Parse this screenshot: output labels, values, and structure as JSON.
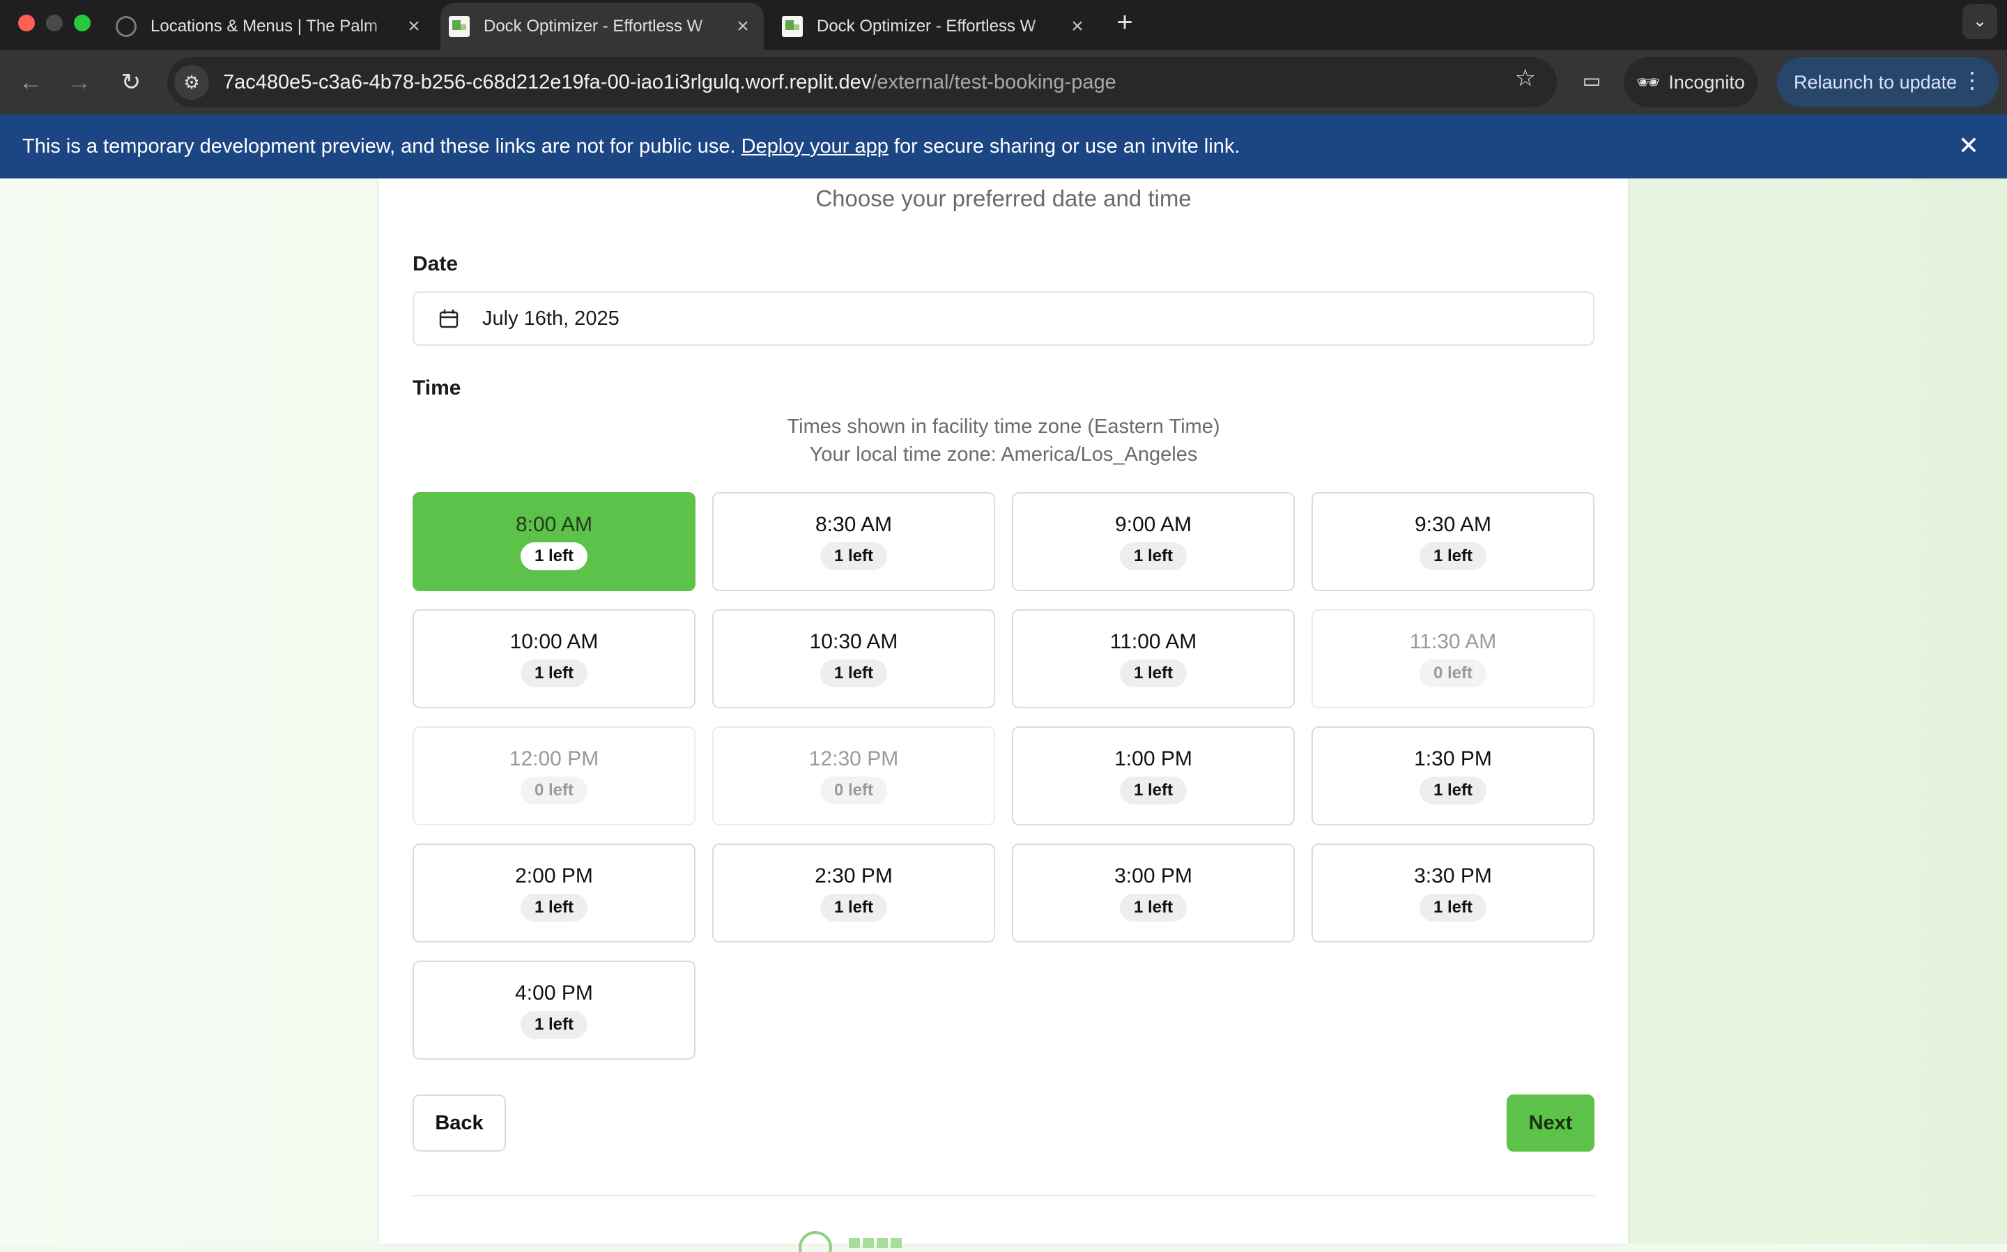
{
  "browser": {
    "tabs": [
      {
        "title": "Locations & Menus | The Palm"
      },
      {
        "title": "Dock Optimizer - Effortless W"
      },
      {
        "title": "Dock Optimizer - Effortless W"
      }
    ],
    "url_host": "7ac480e5-c3a6-4b78-b256-c68d212e19fa-00-iao1i3rlgulq.worf.replit.dev",
    "url_path": "/external/test-booking-page",
    "incognito_label": "Incognito",
    "relaunch_label": "Relaunch to update"
  },
  "banner": {
    "text_before": "This is a temporary development preview, and these links are not for public use.",
    "link_text": "Deploy your app",
    "text_after": "for secure sharing or use an invite link."
  },
  "booking": {
    "subtitle": "Choose your preferred date and time",
    "date_label": "Date",
    "date_value": "July 16th, 2025",
    "time_label": "Time",
    "tz_line1": "Times shown in facility time zone (Eastern Time)",
    "tz_line2": "Your local time zone: America/Los_Angeles",
    "slots": [
      {
        "time": "8:00 AM",
        "badge": "1 left",
        "state": "selected"
      },
      {
        "time": "8:30 AM",
        "badge": "1 left",
        "state": "available"
      },
      {
        "time": "9:00 AM",
        "badge": "1 left",
        "state": "available"
      },
      {
        "time": "9:30 AM",
        "badge": "1 left",
        "state": "available"
      },
      {
        "time": "10:00 AM",
        "badge": "1 left",
        "state": "available"
      },
      {
        "time": "10:30 AM",
        "badge": "1 left",
        "state": "available"
      },
      {
        "time": "11:00 AM",
        "badge": "1 left",
        "state": "available"
      },
      {
        "time": "11:30 AM",
        "badge": "0 left",
        "state": "disabled"
      },
      {
        "time": "12:00 PM",
        "badge": "0 left",
        "state": "disabled"
      },
      {
        "time": "12:30 PM",
        "badge": "0 left",
        "state": "disabled"
      },
      {
        "time": "1:00 PM",
        "badge": "1 left",
        "state": "available"
      },
      {
        "time": "1:30 PM",
        "badge": "1 left",
        "state": "available"
      },
      {
        "time": "2:00 PM",
        "badge": "1 left",
        "state": "available"
      },
      {
        "time": "2:30 PM",
        "badge": "1 left",
        "state": "available"
      },
      {
        "time": "3:00 PM",
        "badge": "1 left",
        "state": "available"
      },
      {
        "time": "3:30 PM",
        "badge": "1 left",
        "state": "available"
      },
      {
        "time": "4:00 PM",
        "badge": "1 left",
        "state": "available"
      }
    ],
    "back_label": "Back",
    "next_label": "Next"
  },
  "colors": {
    "accent_green": "#5dc24a",
    "banner_blue": "#1c4583"
  }
}
